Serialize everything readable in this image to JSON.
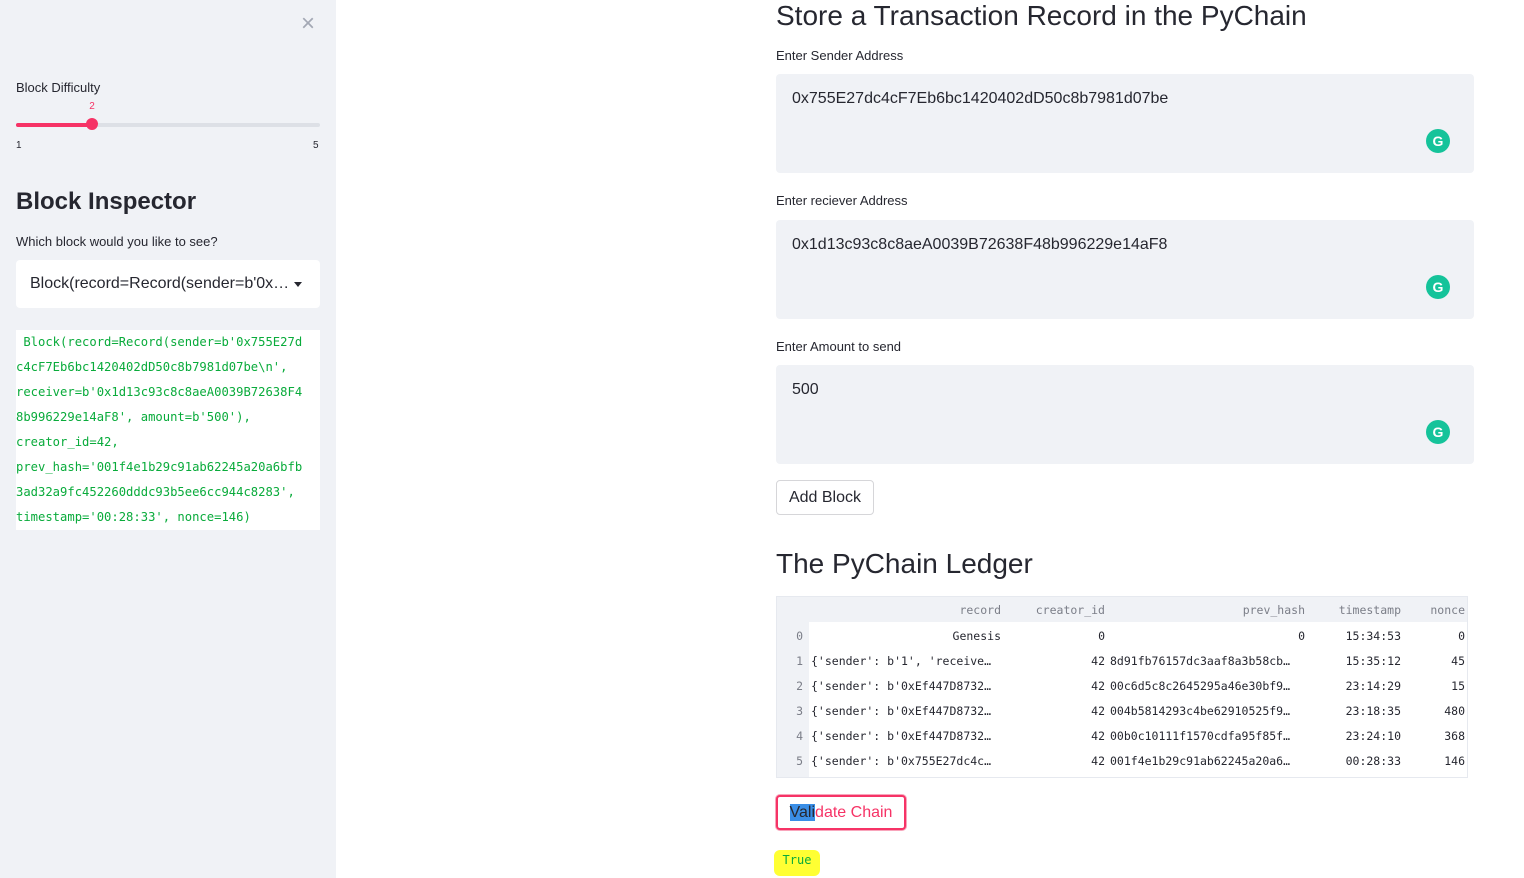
{
  "sidebar": {
    "close_glyph": "×",
    "slider": {
      "label": "Block Difficulty",
      "value": 2,
      "value_label": "2",
      "min": 1,
      "max": 5,
      "min_label": "1",
      "max_label": "5"
    },
    "inspector_title": "Block Inspector",
    "inspector_question": "Which block would you like to see?",
    "selected_block": "Block(record=Record(sender=b'0x755E27dc4cF7Eb6bc1420402dD50c8b7981d07be\\n'",
    "block_output_lines": [
      " Block(record=Record(sender=b'0x755E27d",
      "c4cF7Eb6bc1420402dD50c8b7981d07be\\n',",
      "receiver=b'0x1d13c93c8c8aeA0039B72638F4",
      "8b996229e14aF8', amount=b'500'),",
      "creator_id=42,",
      "prev_hash='001f4e1b29c91ab62245a20a6bfb",
      "3ad32a9fc452260dddc93b5ee6cc944c8283',",
      "timestamp='00:28:33', nonce=146) "
    ]
  },
  "main": {
    "title": "Store a Transaction Record in the PyChain",
    "sender": {
      "label": "Enter Sender Address",
      "value": "0x755E27dc4cF7Eb6bc1420402dD50c8b7981d07be"
    },
    "receiver": {
      "label": "Enter reciever Address",
      "value": "0x1d13c93c8c8aeA0039B72638F48b996229e14aF8"
    },
    "amount": {
      "label": "Enter Amount to send",
      "value": "500"
    },
    "grammarly_glyph": "G",
    "add_block_label": "Add Block",
    "ledger_title": "The PyChain Ledger",
    "ledger": {
      "columns": [
        "record",
        "creator_id",
        "prev_hash",
        "timestamp",
        "nonce"
      ],
      "rows": [
        {
          "index": "0",
          "record": "Genesis",
          "creator_id": "0",
          "prev_hash": "0",
          "timestamp": "15:34:53",
          "nonce": "0"
        },
        {
          "index": "1",
          "record": "{'sender': b'1', 'receive…",
          "creator_id": "42",
          "prev_hash": "8d91fb76157dc3aaf8a3b58cb…",
          "timestamp": "15:35:12",
          "nonce": "45"
        },
        {
          "index": "2",
          "record": "{'sender': b'0xEf447D8732…",
          "creator_id": "42",
          "prev_hash": "00c6d5c8c2645295a46e30bf9…",
          "timestamp": "23:14:29",
          "nonce": "15"
        },
        {
          "index": "3",
          "record": "{'sender': b'0xEf447D8732…",
          "creator_id": "42",
          "prev_hash": "004b5814293c4be62910525f9…",
          "timestamp": "23:18:35",
          "nonce": "480"
        },
        {
          "index": "4",
          "record": "{'sender': b'0xEf447D8732…",
          "creator_id": "42",
          "prev_hash": "00b0c10111f1570cdfa95f85f…",
          "timestamp": "23:24:10",
          "nonce": "368"
        },
        {
          "index": "5",
          "record": "{'sender': b'0x755E27dc4c…",
          "creator_id": "42",
          "prev_hash": "001f4e1b29c91ab62245a20a6…",
          "timestamp": "00:28:33",
          "nonce": "146"
        }
      ]
    },
    "validate": {
      "selected_part": "Vali",
      "rest": "date Chain"
    },
    "validate_result": "True"
  },
  "colors": {
    "accent": "#f63366",
    "success_text": "#09ab3b",
    "highlight": "#ffff33",
    "sidebar_bg": "#f0f2f6"
  }
}
